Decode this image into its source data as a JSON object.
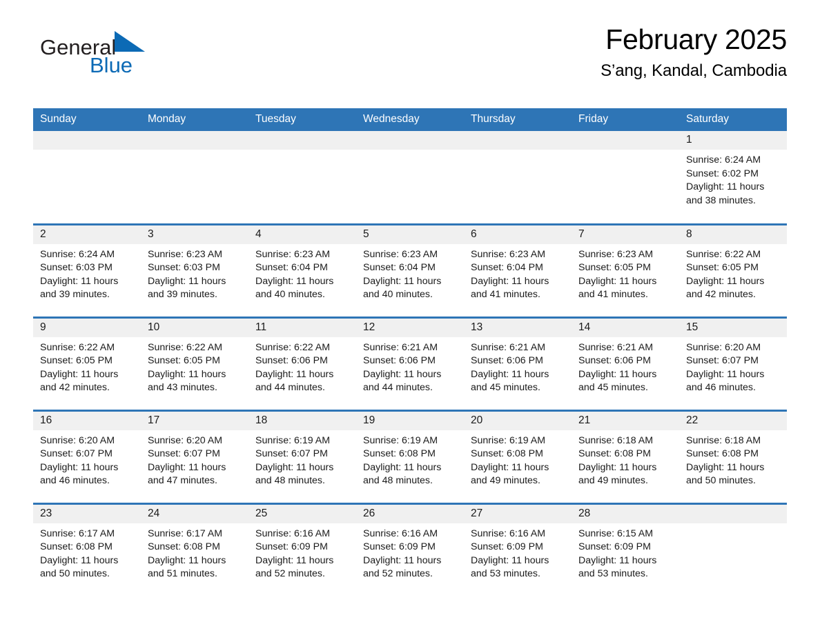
{
  "brand": {
    "name_part1": "General",
    "name_part2": "Blue",
    "accent_color": "#0c6ab5"
  },
  "header": {
    "title": "February 2025",
    "subtitle": "S’ang, Kandal, Cambodia"
  },
  "calendar": {
    "header_color": "#2e75b6",
    "daynum_bg": "#f0f0f0",
    "weekday_headers": [
      "Sunday",
      "Monday",
      "Tuesday",
      "Wednesday",
      "Thursday",
      "Friday",
      "Saturday"
    ],
    "weeks": [
      [
        {
          "day": "",
          "blank": true
        },
        {
          "day": "",
          "blank": true
        },
        {
          "day": "",
          "blank": true
        },
        {
          "day": "",
          "blank": true
        },
        {
          "day": "",
          "blank": true
        },
        {
          "day": "",
          "blank": true
        },
        {
          "day": "1",
          "sunrise": "Sunrise: 6:24 AM",
          "sunset": "Sunset: 6:02 PM",
          "daylight": "Daylight: 11 hours and 38 minutes."
        }
      ],
      [
        {
          "day": "2",
          "sunrise": "Sunrise: 6:24 AM",
          "sunset": "Sunset: 6:03 PM",
          "daylight": "Daylight: 11 hours and 39 minutes."
        },
        {
          "day": "3",
          "sunrise": "Sunrise: 6:23 AM",
          "sunset": "Sunset: 6:03 PM",
          "daylight": "Daylight: 11 hours and 39 minutes."
        },
        {
          "day": "4",
          "sunrise": "Sunrise: 6:23 AM",
          "sunset": "Sunset: 6:04 PM",
          "daylight": "Daylight: 11 hours and 40 minutes."
        },
        {
          "day": "5",
          "sunrise": "Sunrise: 6:23 AM",
          "sunset": "Sunset: 6:04 PM",
          "daylight": "Daylight: 11 hours and 40 minutes."
        },
        {
          "day": "6",
          "sunrise": "Sunrise: 6:23 AM",
          "sunset": "Sunset: 6:04 PM",
          "daylight": "Daylight: 11 hours and 41 minutes."
        },
        {
          "day": "7",
          "sunrise": "Sunrise: 6:23 AM",
          "sunset": "Sunset: 6:05 PM",
          "daylight": "Daylight: 11 hours and 41 minutes."
        },
        {
          "day": "8",
          "sunrise": "Sunrise: 6:22 AM",
          "sunset": "Sunset: 6:05 PM",
          "daylight": "Daylight: 11 hours and 42 minutes."
        }
      ],
      [
        {
          "day": "9",
          "sunrise": "Sunrise: 6:22 AM",
          "sunset": "Sunset: 6:05 PM",
          "daylight": "Daylight: 11 hours and 42 minutes."
        },
        {
          "day": "10",
          "sunrise": "Sunrise: 6:22 AM",
          "sunset": "Sunset: 6:05 PM",
          "daylight": "Daylight: 11 hours and 43 minutes."
        },
        {
          "day": "11",
          "sunrise": "Sunrise: 6:22 AM",
          "sunset": "Sunset: 6:06 PM",
          "daylight": "Daylight: 11 hours and 44 minutes."
        },
        {
          "day": "12",
          "sunrise": "Sunrise: 6:21 AM",
          "sunset": "Sunset: 6:06 PM",
          "daylight": "Daylight: 11 hours and 44 minutes."
        },
        {
          "day": "13",
          "sunrise": "Sunrise: 6:21 AM",
          "sunset": "Sunset: 6:06 PM",
          "daylight": "Daylight: 11 hours and 45 minutes."
        },
        {
          "day": "14",
          "sunrise": "Sunrise: 6:21 AM",
          "sunset": "Sunset: 6:06 PM",
          "daylight": "Daylight: 11 hours and 45 minutes."
        },
        {
          "day": "15",
          "sunrise": "Sunrise: 6:20 AM",
          "sunset": "Sunset: 6:07 PM",
          "daylight": "Daylight: 11 hours and 46 minutes."
        }
      ],
      [
        {
          "day": "16",
          "sunrise": "Sunrise: 6:20 AM",
          "sunset": "Sunset: 6:07 PM",
          "daylight": "Daylight: 11 hours and 46 minutes."
        },
        {
          "day": "17",
          "sunrise": "Sunrise: 6:20 AM",
          "sunset": "Sunset: 6:07 PM",
          "daylight": "Daylight: 11 hours and 47 minutes."
        },
        {
          "day": "18",
          "sunrise": "Sunrise: 6:19 AM",
          "sunset": "Sunset: 6:07 PM",
          "daylight": "Daylight: 11 hours and 48 minutes."
        },
        {
          "day": "19",
          "sunrise": "Sunrise: 6:19 AM",
          "sunset": "Sunset: 6:08 PM",
          "daylight": "Daylight: 11 hours and 48 minutes."
        },
        {
          "day": "20",
          "sunrise": "Sunrise: 6:19 AM",
          "sunset": "Sunset: 6:08 PM",
          "daylight": "Daylight: 11 hours and 49 minutes."
        },
        {
          "day": "21",
          "sunrise": "Sunrise: 6:18 AM",
          "sunset": "Sunset: 6:08 PM",
          "daylight": "Daylight: 11 hours and 49 minutes."
        },
        {
          "day": "22",
          "sunrise": "Sunrise: 6:18 AM",
          "sunset": "Sunset: 6:08 PM",
          "daylight": "Daylight: 11 hours and 50 minutes."
        }
      ],
      [
        {
          "day": "23",
          "sunrise": "Sunrise: 6:17 AM",
          "sunset": "Sunset: 6:08 PM",
          "daylight": "Daylight: 11 hours and 50 minutes."
        },
        {
          "day": "24",
          "sunrise": "Sunrise: 6:17 AM",
          "sunset": "Sunset: 6:08 PM",
          "daylight": "Daylight: 11 hours and 51 minutes."
        },
        {
          "day": "25",
          "sunrise": "Sunrise: 6:16 AM",
          "sunset": "Sunset: 6:09 PM",
          "daylight": "Daylight: 11 hours and 52 minutes."
        },
        {
          "day": "26",
          "sunrise": "Sunrise: 6:16 AM",
          "sunset": "Sunset: 6:09 PM",
          "daylight": "Daylight: 11 hours and 52 minutes."
        },
        {
          "day": "27",
          "sunrise": "Sunrise: 6:16 AM",
          "sunset": "Sunset: 6:09 PM",
          "daylight": "Daylight: 11 hours and 53 minutes."
        },
        {
          "day": "28",
          "sunrise": "Sunrise: 6:15 AM",
          "sunset": "Sunset: 6:09 PM",
          "daylight": "Daylight: 11 hours and 53 minutes."
        },
        {
          "day": "",
          "blank": true
        }
      ]
    ]
  }
}
